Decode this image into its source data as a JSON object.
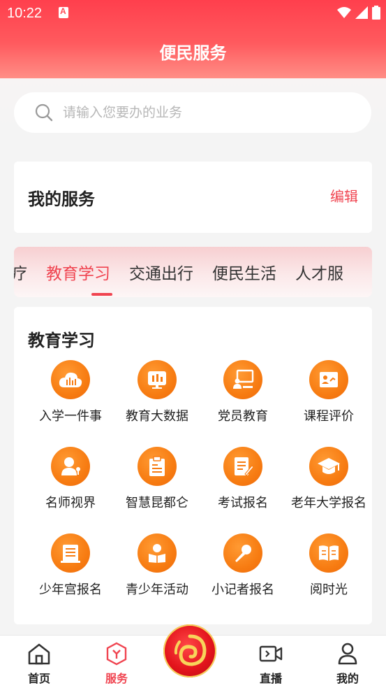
{
  "status": {
    "time": "10:22"
  },
  "header": {
    "title": "便民服务"
  },
  "search": {
    "placeholder": "请输入您要办的业务"
  },
  "my_services": {
    "title": "我的服务",
    "edit": "编辑"
  },
  "tabs": [
    "医疗",
    "教育学习",
    "交通出行",
    "便民生活",
    "人才服"
  ],
  "active_tab": 1,
  "section": {
    "title": "教育学习",
    "items": [
      {
        "label": "入学一件事",
        "icon": "cloud-chart-icon"
      },
      {
        "label": "教育大数据",
        "icon": "data-screen-icon"
      },
      {
        "label": "党员教育",
        "icon": "presentation-icon"
      },
      {
        "label": "课程评价",
        "icon": "evaluation-icon"
      },
      {
        "label": "名师视界",
        "icon": "teacher-icon"
      },
      {
        "label": "智慧昆都仑",
        "icon": "clipboard-icon"
      },
      {
        "label": "考试报名",
        "icon": "exam-icon"
      },
      {
        "label": "老年大学报名",
        "icon": "graduation-cap-icon"
      },
      {
        "label": "少年宫报名",
        "icon": "building-icon"
      },
      {
        "label": "青少年活动",
        "icon": "reading-person-icon"
      },
      {
        "label": "小记者报名",
        "icon": "microphone-icon"
      },
      {
        "label": "阅时光",
        "icon": "book-icon"
      }
    ]
  },
  "bottom_nav": [
    {
      "label": "首页",
      "icon": "home-icon"
    },
    {
      "label": "服务",
      "icon": "service-icon"
    },
    {
      "label": "直播",
      "icon": "live-video-icon"
    },
    {
      "label": "我的",
      "icon": "user-icon"
    }
  ],
  "colors": {
    "accent": "#f04450",
    "icon_orange": "#f77c12",
    "header_red": "#ff4350"
  }
}
